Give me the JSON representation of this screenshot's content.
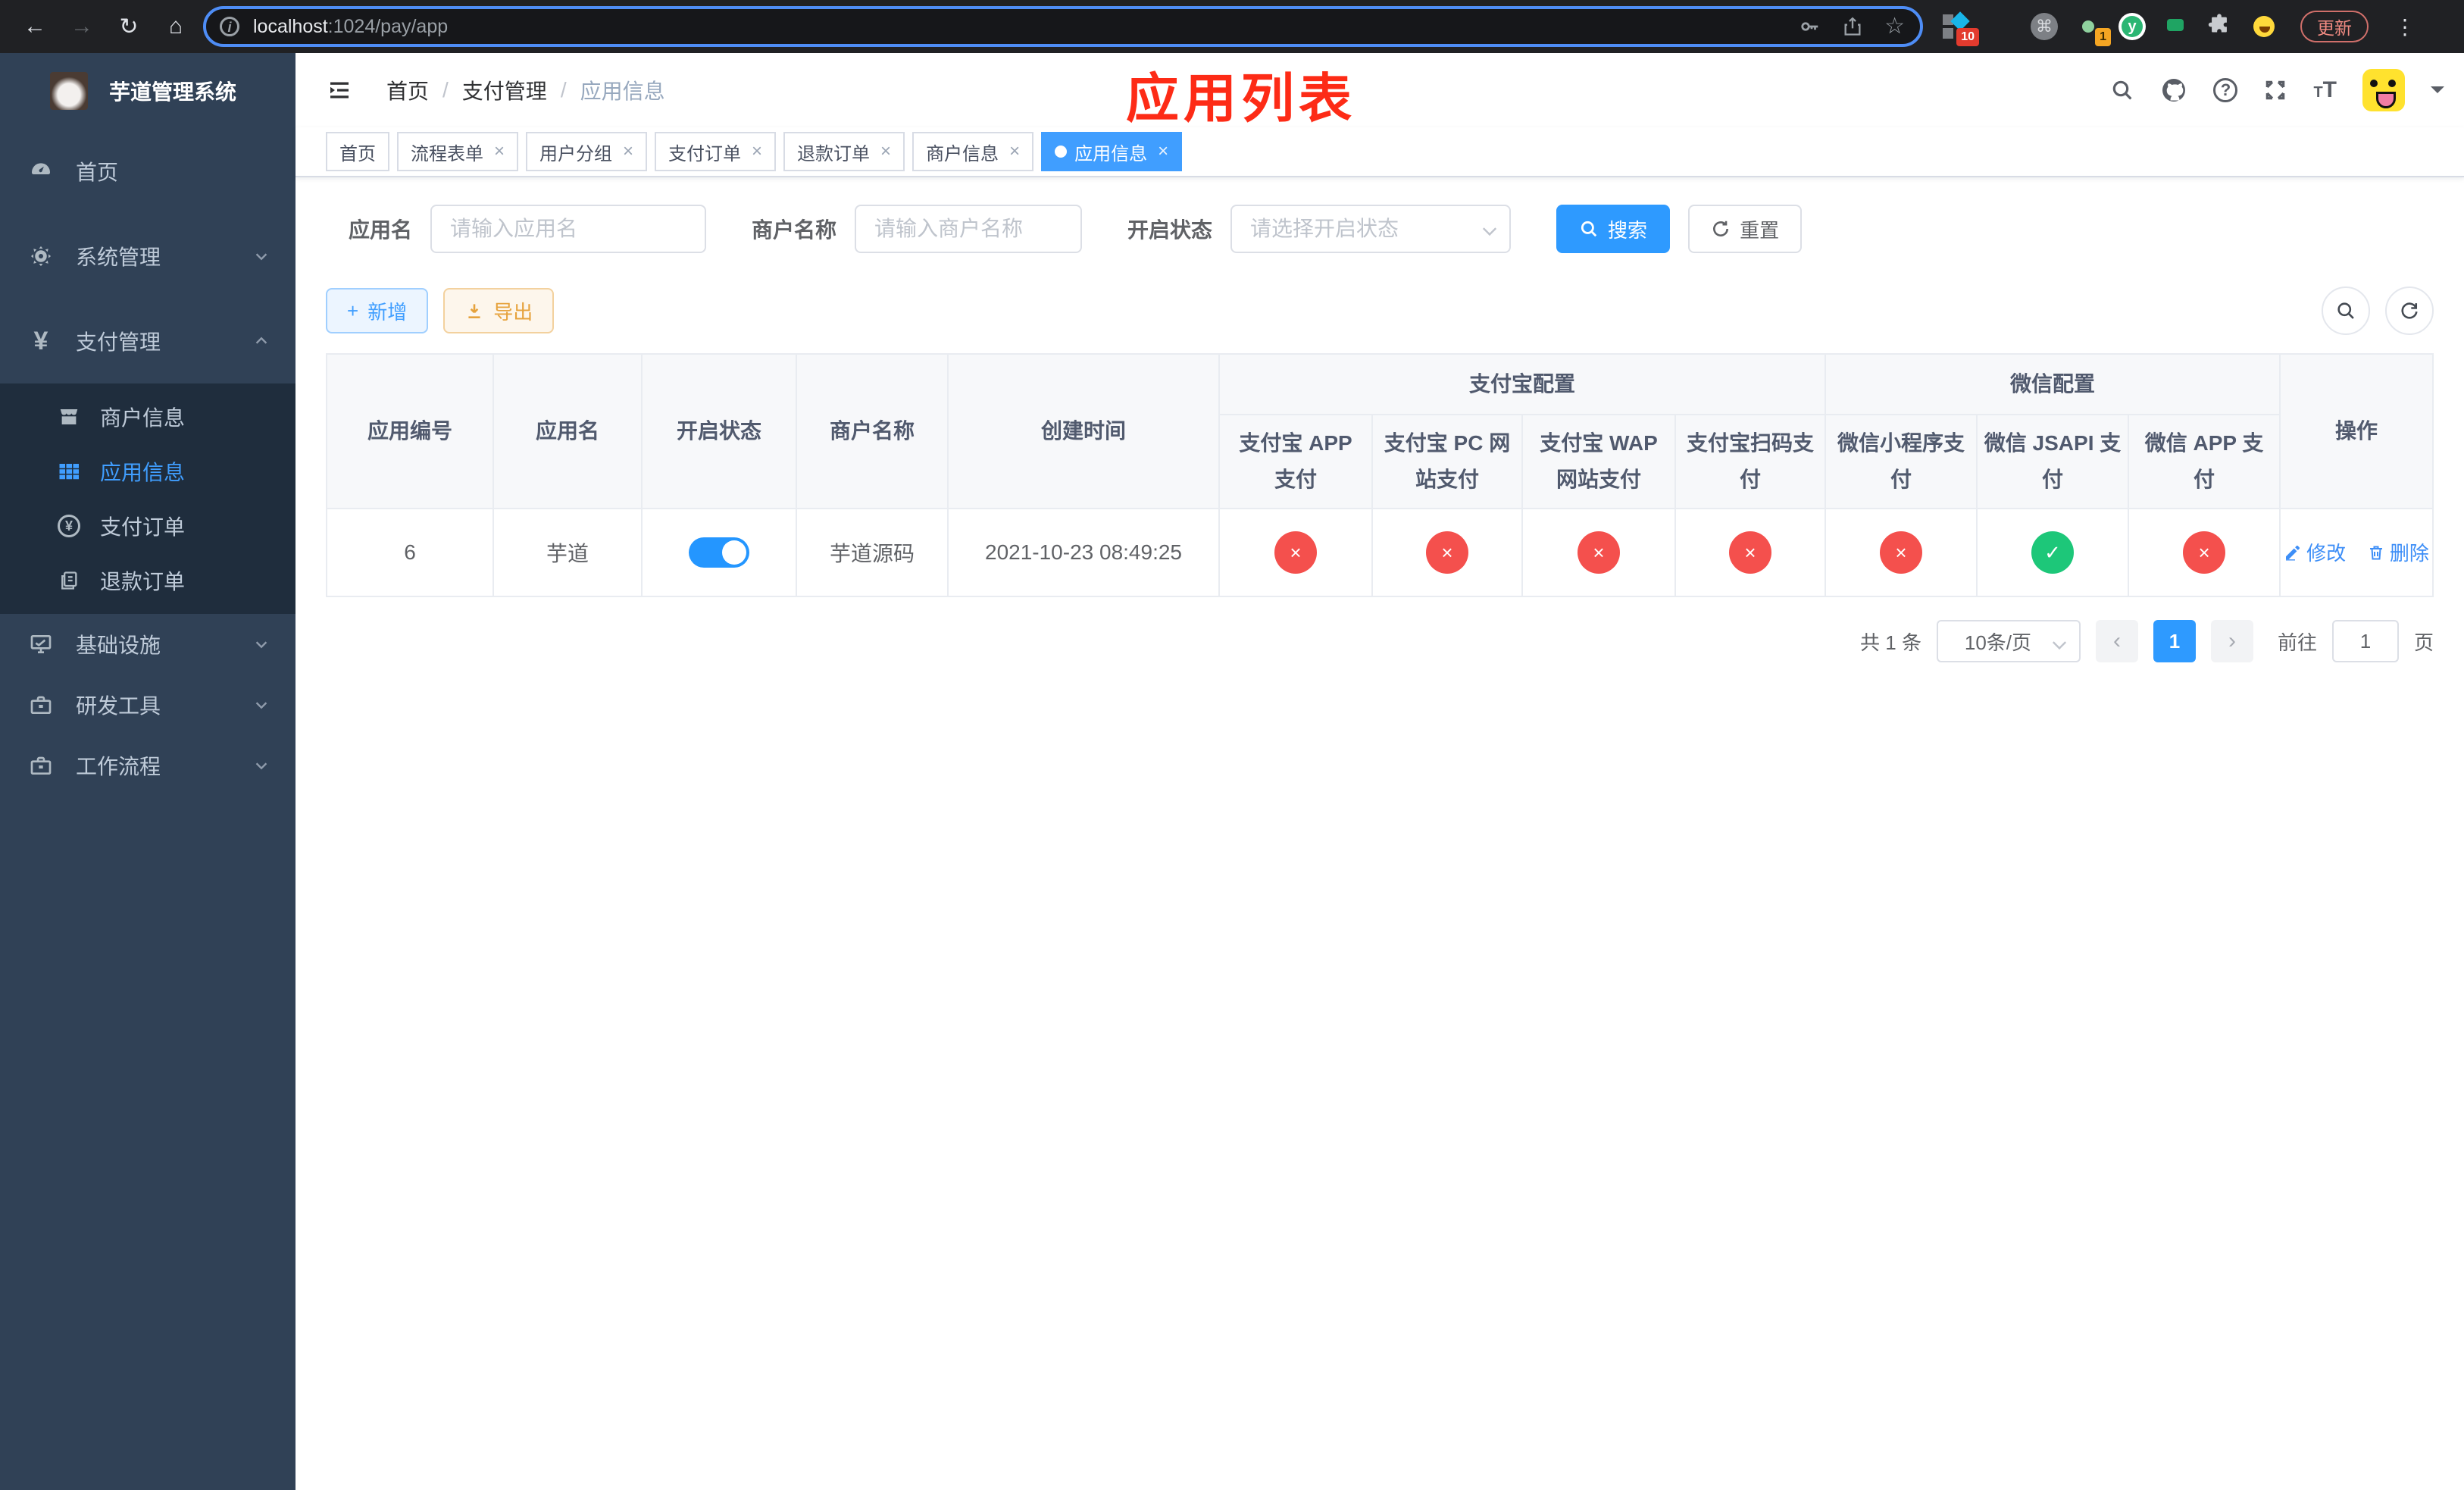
{
  "browser": {
    "url_host": "localhost",
    "url_path": ":1024/pay/app",
    "update_button": "更新",
    "extension_badge_scripts": "10",
    "extension_badge_profile": "1"
  },
  "glyphs": {
    "back": "←",
    "forward": "→",
    "reload": "↻",
    "home": "⌂",
    "info": "i",
    "star": "☆",
    "cmd": "⌘",
    "menu_dots": "⋮",
    "question": "?",
    "font_size_small": "T",
    "font_size_big": "T",
    "yen": "¥",
    "plus": "+",
    "close": "×",
    "check": "✓",
    "cross": "×",
    "prev": "‹",
    "next": "›",
    "y_logo": "y"
  },
  "sidebar": {
    "app_title": "芋道管理系统",
    "menu": [
      {
        "label": "首页"
      },
      {
        "label": "系统管理"
      },
      {
        "label": "支付管理"
      },
      {
        "label": "基础设施"
      },
      {
        "label": "研发工具"
      },
      {
        "label": "工作流程"
      }
    ],
    "payment_submenu": [
      {
        "label": "商户信息"
      },
      {
        "label": "应用信息"
      },
      {
        "label": "支付订单"
      },
      {
        "label": "退款订单"
      }
    ]
  },
  "header": {
    "breadcrumb": [
      "首页",
      "支付管理",
      "应用信息"
    ],
    "annotation": "应用列表"
  },
  "tabs": [
    {
      "label": "首页"
    },
    {
      "label": "流程表单"
    },
    {
      "label": "用户分组"
    },
    {
      "label": "支付订单"
    },
    {
      "label": "退款订单"
    },
    {
      "label": "商户信息"
    },
    {
      "label": "应用信息"
    }
  ],
  "filters": {
    "app_name_label": "应用名",
    "app_name_placeholder": "请输入应用名",
    "merchant_label": "商户名称",
    "merchant_placeholder": "请输入商户名称",
    "status_label": "开启状态",
    "status_placeholder": "请选择开启状态",
    "search_button": "搜索",
    "reset_button": "重置"
  },
  "toolbar": {
    "add_button": "新增",
    "export_button": "导出"
  },
  "table": {
    "columns": [
      "应用编号",
      "应用名",
      "开启状态",
      "商户名称",
      "创建时间"
    ],
    "groups": [
      {
        "label": "支付宝配置",
        "columns": [
          "支付宝 APP 支付",
          "支付宝 PC 网站支付",
          "支付宝 WAP 网站支付",
          "支付宝扫码支付"
        ]
      },
      {
        "label": "微信配置",
        "columns": [
          "微信小程序支付",
          "微信 JSAPI 支付",
          "微信 APP 支付"
        ]
      }
    ],
    "actions_column": "操作",
    "row": {
      "id": "6",
      "app_name": "芋道",
      "enabled": true,
      "merchant_name": "芋道源码",
      "created_at": "2021-10-23 08:49:25",
      "channel_status": [
        false,
        false,
        false,
        false,
        false,
        true,
        false
      ],
      "edit_action": "修改",
      "delete_action": "删除"
    }
  },
  "pagination": {
    "total_text": "共 1 条",
    "page_size": "10条/页",
    "current_page": "1",
    "goto_label": "前往",
    "goto_value": "1",
    "goto_suffix": "页"
  },
  "colors": {
    "accent_blue": "#409eff",
    "success_green": "#1dc779",
    "danger_red": "#f4504d",
    "warning_orange": "#e6a23c",
    "sidebar_bg": "#304156",
    "submenu_bg": "#1f2d3d",
    "annotation_red": "#fd2b16"
  }
}
